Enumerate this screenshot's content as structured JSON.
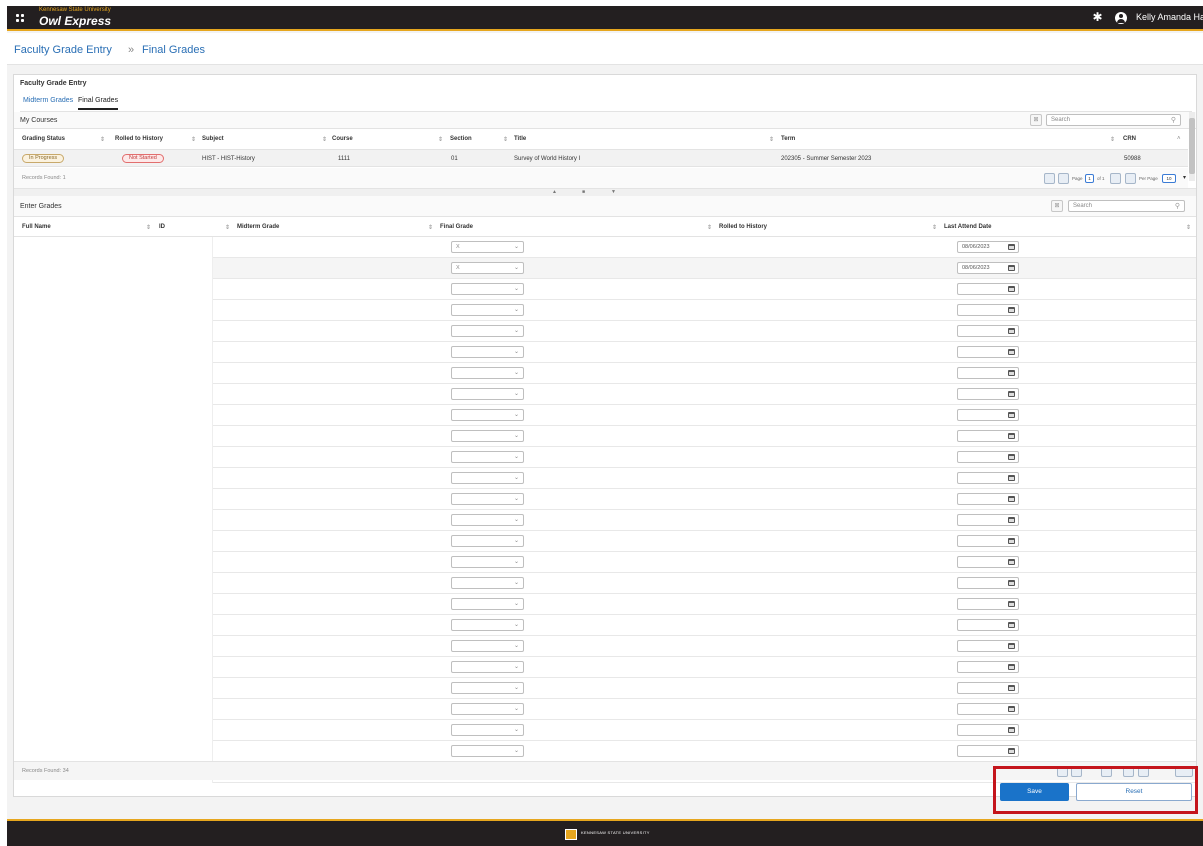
{
  "app": {
    "university": "Kennesaw State University",
    "name": "Owl Express",
    "user_name": "Kelly Amanda Harden"
  },
  "breadcrumb": [
    {
      "label": "Faculty Grade Entry"
    },
    {
      "separator": "»"
    },
    {
      "label": "Final Grades"
    }
  ],
  "panel_title": "Faculty Grade Entry",
  "tabs": [
    {
      "label": "Midterm Grades",
      "active": false
    },
    {
      "label": "Final Grades",
      "active": true
    }
  ],
  "my_courses": {
    "title": "My Courses",
    "search_placeholder": "Search",
    "columns": [
      "Grading Status",
      "Rolled to History",
      "Subject",
      "Course",
      "Section",
      "Title",
      "Term",
      "CRN"
    ],
    "row": {
      "grading_status": "In Progress",
      "rolled_to_history": "Not Started",
      "subject": "HIST - HIST-History",
      "course": "1111",
      "section": "01",
      "title": "Survey of World History I",
      "term": "202305 - Summer Semester 2023",
      "crn": "50988"
    },
    "records_found": "Records Found: 1",
    "pagination": {
      "page_label": "Page",
      "page_value": "1",
      "of_label": "of 1",
      "per_page_label": "Per Page",
      "per_page_value": "10"
    }
  },
  "enter_grades": {
    "title": "Enter Grades",
    "search_placeholder": "Search",
    "columns": [
      "Full Name",
      "ID",
      "Midterm Grade",
      "Final Grade",
      "Rolled to History",
      "Last Attend Date"
    ],
    "rows": [
      {
        "final_grade": "X",
        "last_attend": "08/06/2023"
      },
      {
        "final_grade": "X",
        "last_attend": "08/06/2023"
      },
      {
        "final_grade": "",
        "last_attend": ""
      },
      {
        "final_grade": "",
        "last_attend": ""
      },
      {
        "final_grade": "",
        "last_attend": ""
      },
      {
        "final_grade": "",
        "last_attend": ""
      },
      {
        "final_grade": "",
        "last_attend": ""
      },
      {
        "final_grade": "",
        "last_attend": ""
      },
      {
        "final_grade": "",
        "last_attend": ""
      },
      {
        "final_grade": "",
        "last_attend": ""
      },
      {
        "final_grade": "",
        "last_attend": ""
      },
      {
        "final_grade": "",
        "last_attend": ""
      },
      {
        "final_grade": "",
        "last_attend": ""
      },
      {
        "final_grade": "",
        "last_attend": ""
      },
      {
        "final_grade": "",
        "last_attend": ""
      },
      {
        "final_grade": "",
        "last_attend": ""
      },
      {
        "final_grade": "",
        "last_attend": ""
      },
      {
        "final_grade": "",
        "last_attend": ""
      },
      {
        "final_grade": "",
        "last_attend": ""
      },
      {
        "final_grade": "",
        "last_attend": ""
      },
      {
        "final_grade": "",
        "last_attend": ""
      },
      {
        "final_grade": "",
        "last_attend": ""
      },
      {
        "final_grade": "",
        "last_attend": ""
      },
      {
        "final_grade": "",
        "last_attend": ""
      },
      {
        "final_grade": "",
        "last_attend": ""
      },
      {
        "final_grade": "",
        "last_attend": ""
      }
    ],
    "records_found": "Records Found: 34"
  },
  "actions": {
    "save_label": "Save",
    "reset_label": "Reset"
  },
  "footer": {
    "logo_text": "KENNESAW STATE UNIVERSITY"
  },
  "colors": {
    "topbar": "#231f20",
    "gold": "#e6a61e",
    "link": "#2a6fb5",
    "primary_button": "#1a73c9",
    "highlight": "#c4151c"
  }
}
